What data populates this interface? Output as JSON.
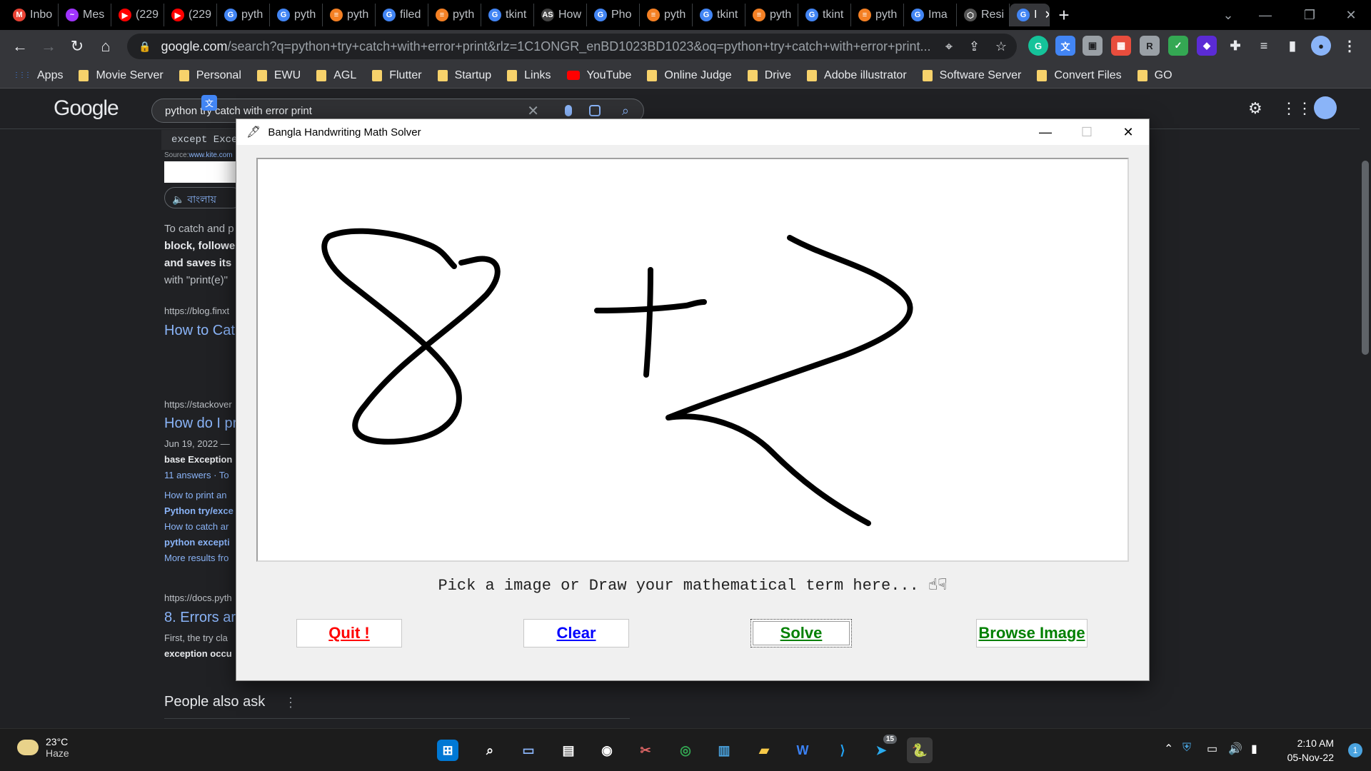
{
  "browser": {
    "tabs": [
      {
        "label": "Inbo",
        "icon": "gmail-icon",
        "color": "#ea4335",
        "glyph": "M"
      },
      {
        "label": "Mes",
        "icon": "messenger-icon",
        "color": "#a033ff",
        "glyph": "~"
      },
      {
        "label": "(229",
        "icon": "youtube-icon",
        "color": "#ff0000",
        "glyph": "▶"
      },
      {
        "label": "(229",
        "icon": "youtube-icon",
        "color": "#ff0000",
        "glyph": "▶"
      },
      {
        "label": "pyth",
        "icon": "google-icon",
        "color": "#4285f4",
        "glyph": "G"
      },
      {
        "label": "pyth",
        "icon": "google-icon",
        "color": "#4285f4",
        "glyph": "G"
      },
      {
        "label": "pyth",
        "icon": "stackoverflow-icon",
        "color": "#f48024",
        "glyph": "≡"
      },
      {
        "label": "filed",
        "icon": "google-icon",
        "color": "#4285f4",
        "glyph": "G"
      },
      {
        "label": "pyth",
        "icon": "stackoverflow-icon",
        "color": "#f48024",
        "glyph": "≡"
      },
      {
        "label": "tkint",
        "icon": "google-icon",
        "color": "#4285f4",
        "glyph": "G"
      },
      {
        "label": "How",
        "icon": "as-icon",
        "color": "#444444",
        "glyph": "AS"
      },
      {
        "label": "Pho",
        "icon": "google-icon",
        "color": "#4285f4",
        "glyph": "G"
      },
      {
        "label": "pyth",
        "icon": "stackoverflow-icon",
        "color": "#f48024",
        "glyph": "≡"
      },
      {
        "label": "tkint",
        "icon": "google-icon",
        "color": "#4285f4",
        "glyph": "G"
      },
      {
        "label": "pyth",
        "icon": "stackoverflow-icon",
        "color": "#f48024",
        "glyph": "≡"
      },
      {
        "label": "tkint",
        "icon": "google-icon",
        "color": "#4285f4",
        "glyph": "G"
      },
      {
        "label": "pyth",
        "icon": "stackoverflow-icon",
        "color": "#f48024",
        "glyph": "≡"
      },
      {
        "label": "Ima",
        "icon": "google-icon",
        "color": "#4285f4",
        "glyph": "G"
      },
      {
        "label": "Resi",
        "icon": "openai-icon",
        "color": "#555555",
        "glyph": "⬡"
      }
    ],
    "active_tab": {
      "label": "I",
      "icon": "google-icon"
    },
    "url_host": "google.com",
    "url_rest": "/search?q=python+try+catch+with+error+print&rlz=1C1ONGR_enBD1023BD1023&oq=python+try+catch+with+error+print...",
    "bookmarks": [
      {
        "label": "Apps",
        "type": "apps"
      },
      {
        "label": "Movie Server",
        "type": "folder"
      },
      {
        "label": "Personal",
        "type": "folder"
      },
      {
        "label": "EWU",
        "type": "folder"
      },
      {
        "label": "AGL",
        "type": "folder"
      },
      {
        "label": "Flutter",
        "type": "folder"
      },
      {
        "label": "Startup",
        "type": "folder"
      },
      {
        "label": "Links",
        "type": "folder"
      },
      {
        "label": "YouTube",
        "type": "youtube"
      },
      {
        "label": "Online Judge",
        "type": "folder"
      },
      {
        "label": "Drive",
        "type": "folder"
      },
      {
        "label": "Adobe illustrator",
        "type": "folder"
      },
      {
        "label": "Software Server",
        "type": "folder"
      },
      {
        "label": "Convert Files",
        "type": "folder"
      },
      {
        "label": "GO",
        "type": "folder"
      }
    ]
  },
  "google": {
    "logo": "Google",
    "query": "python try catch with error print",
    "code_snippet": "except Excep",
    "source_label": "Source:",
    "source_link": "www.kite.com",
    "listen_label": "বাংলায়",
    "snippet_lines": [
      "To catch and p",
      "block, followe",
      "and saves its",
      "with \"print(e)\""
    ],
    "results": [
      {
        "url": "https://blog.finxt",
        "title": "How to Cat"
      },
      {
        "url": "https://stackover",
        "title": "How do I pr",
        "date": "Jun 19, 2022 —",
        "line": "base Exception",
        "answers": "11 answers · To",
        "links": [
          "How to print an",
          "Python try/exce",
          "How to catch ar",
          "python excepti",
          "More results fro"
        ]
      },
      {
        "url": "https://docs.pyth",
        "title": "8. Errors ar",
        "line1": "First, the try cla",
        "line2": "exception occu"
      }
    ],
    "people_also_ask": "People also ask"
  },
  "app": {
    "title": "Bangla Handwriting Math Solver",
    "prompt": "Pick a image or Draw your mathematical term here...",
    "buttons": {
      "quit": "Quit !",
      "clear": "Clear",
      "solve": "Solve",
      "browse": "Browse Image"
    },
    "colors": {
      "quit": "#ff0000",
      "clear": "#0000ff",
      "solve": "#008000",
      "browse": "#008000"
    }
  },
  "taskbar": {
    "temperature": "23°C",
    "condition": "Haze",
    "time": "2:10 AM",
    "date": "05-Nov-22",
    "notification_count": "1",
    "telegram_badge": "15"
  }
}
